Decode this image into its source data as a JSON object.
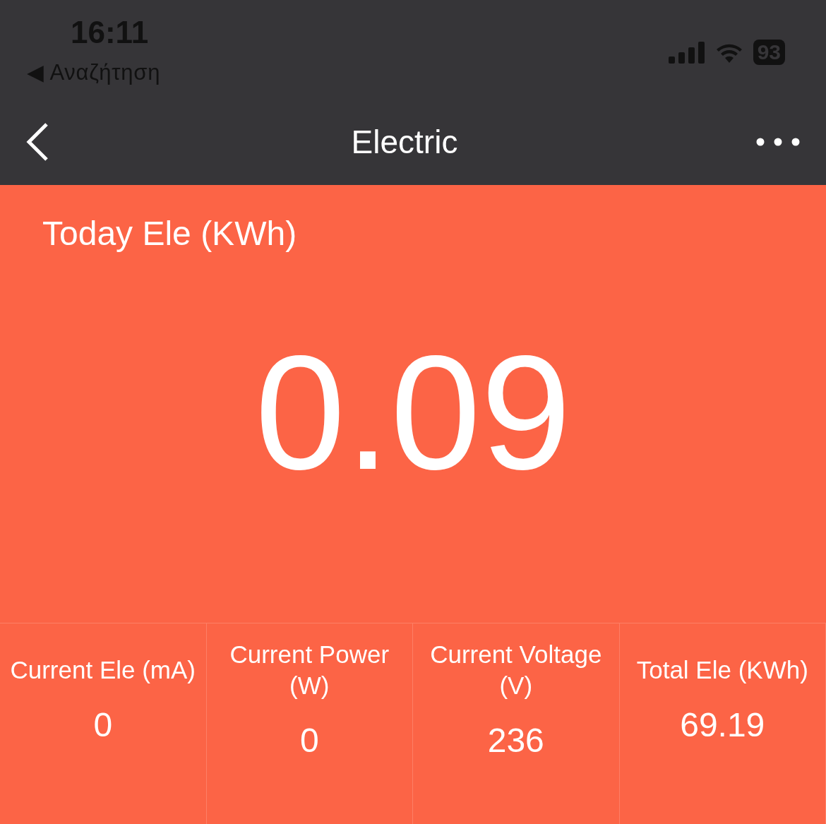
{
  "status_bar": {
    "time": "16:11",
    "back_link": "◀ Αναζήτηση",
    "battery": "93"
  },
  "nav": {
    "title": "Electric"
  },
  "today": {
    "label": "Today Ele (KWh)",
    "value": "0.09"
  },
  "stats": [
    {
      "label": "Current Ele (mA)",
      "value": "0"
    },
    {
      "label": "Current Power (W)",
      "value": "0"
    },
    {
      "label": "Current Voltage (V)",
      "value": "236"
    },
    {
      "label": "Total Ele (KWh)",
      "value": "69.19"
    }
  ]
}
